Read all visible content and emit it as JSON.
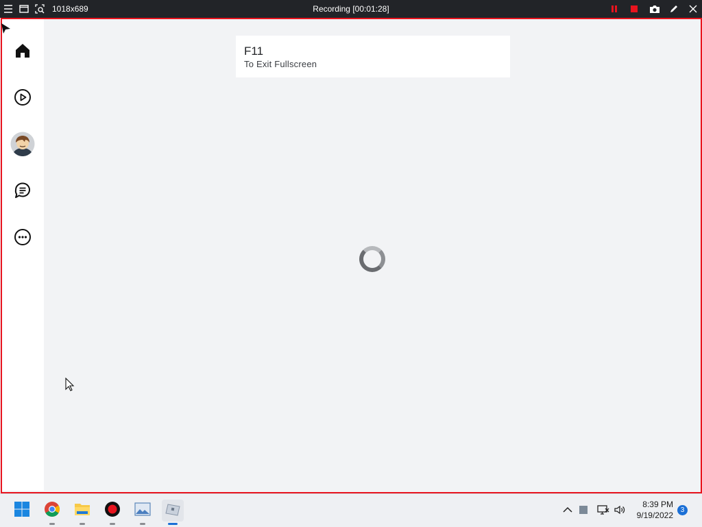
{
  "recorder": {
    "size_label": "1018x689",
    "title": "Recording [00:01:28]",
    "accent_color": "#e8141e"
  },
  "sidebar": {
    "items": [
      {
        "icon": "home-icon"
      },
      {
        "icon": "play-icon"
      },
      {
        "icon": "avatar"
      },
      {
        "icon": "chat-icon"
      },
      {
        "icon": "more-icon"
      }
    ]
  },
  "toast": {
    "key": "F11",
    "message": "To Exit Fullscreen"
  },
  "taskbar": {
    "apps": [
      "windows-start",
      "chrome",
      "file-explorer",
      "recorder",
      "photos",
      "roblox"
    ],
    "clock": {
      "time": "8:39 PM",
      "date": "9/19/2022"
    },
    "notification_count": "3"
  }
}
